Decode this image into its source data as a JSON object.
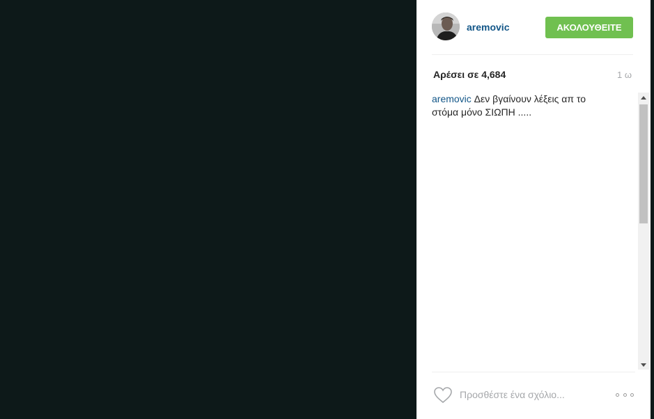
{
  "post": {
    "username": "aremovic",
    "follow_label": "ΑΚΟΛΟΥΘΕΙΤΕ",
    "likes": "Αρέσει σε 4,684",
    "time_ago": "1 ω",
    "caption_user": "aremovic",
    "caption_text": " Δεν βγαίνουν λέξεις απ το στόμα μόνο ΣΙΩΠΗ .....",
    "comment_placeholder": "Προσθέστε ένα σχόλιο..."
  },
  "colors": {
    "photo_background": "#0d1919",
    "follow_button": "#70c050",
    "username": "#125688"
  },
  "icons": {
    "like": "heart-outline-icon",
    "more": "ellipsis-icon",
    "scroll_up": "triangle-up-icon",
    "scroll_down": "triangle-down-icon"
  }
}
